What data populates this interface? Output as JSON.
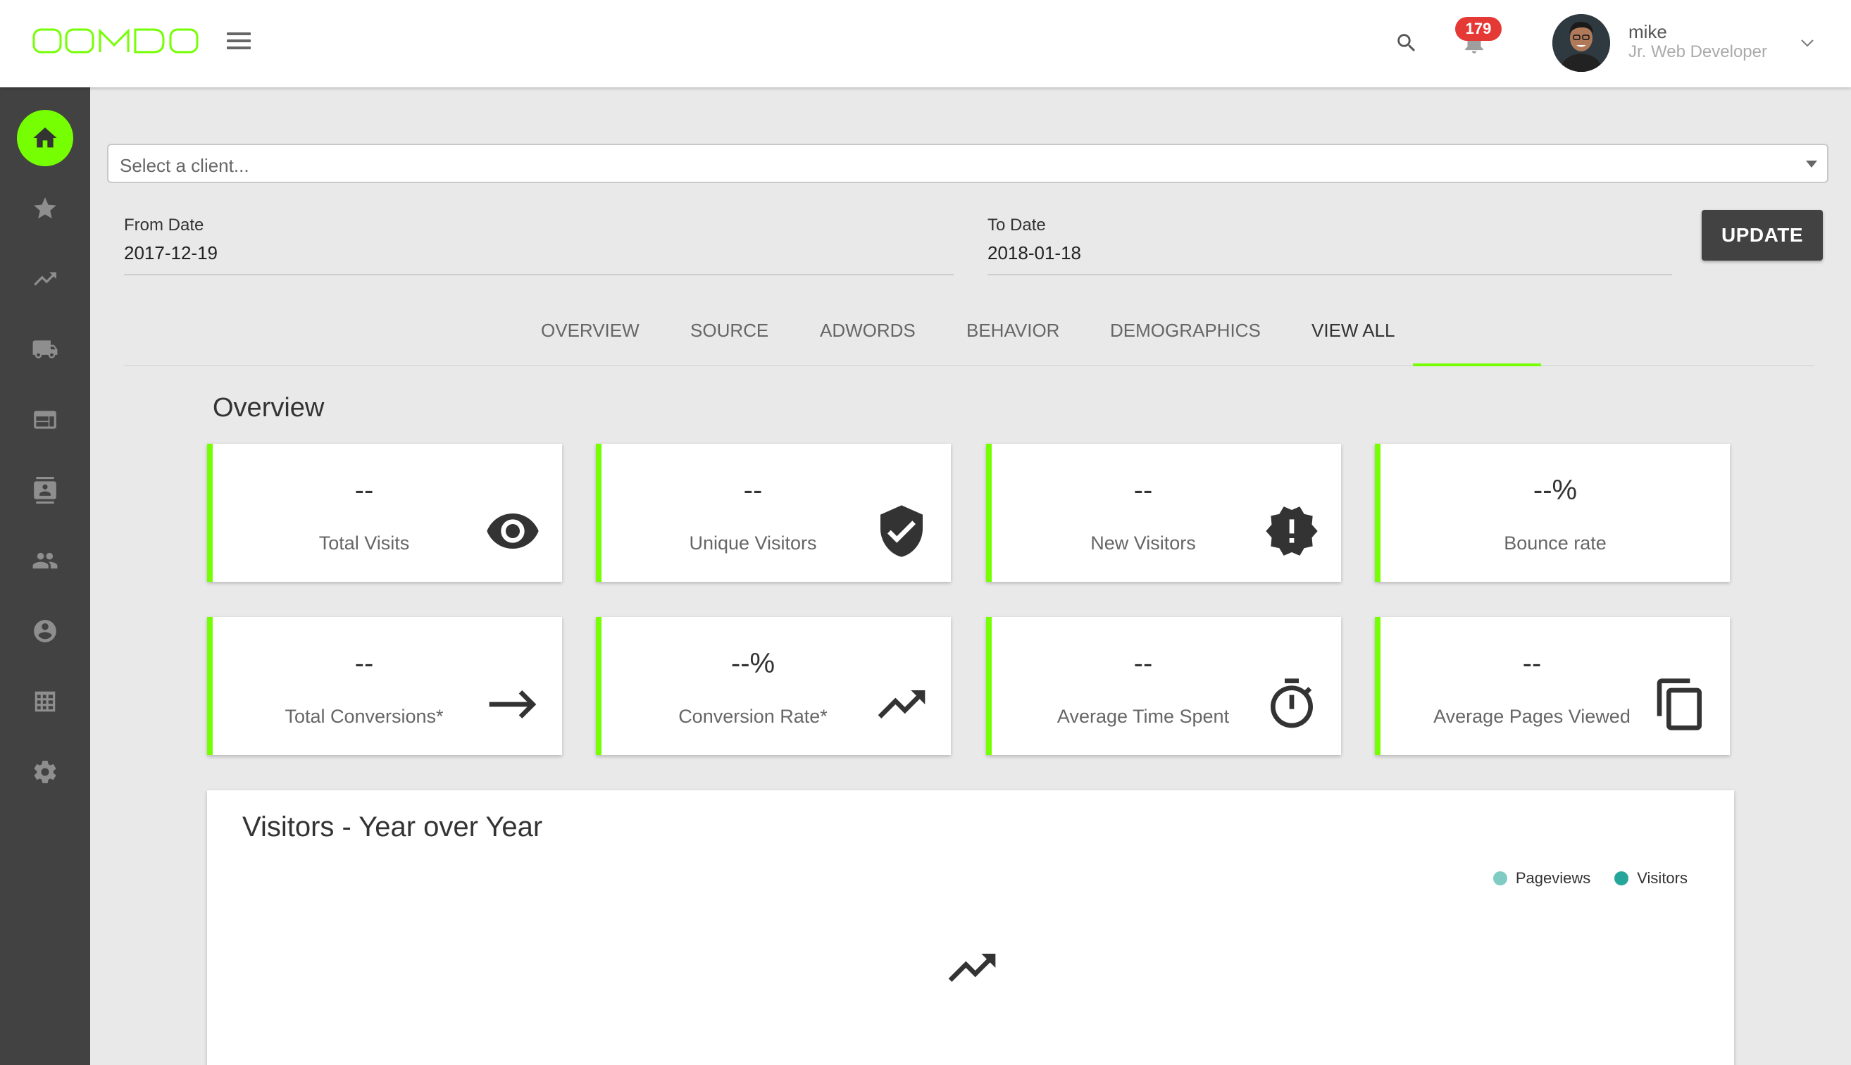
{
  "app": {
    "logo_text": "OOMDO",
    "brand_color": "#76ff03",
    "sidebar_color": "#424242"
  },
  "header": {
    "notifications_count": "179",
    "user": {
      "name": "mike",
      "role": "Jr. Web Developer"
    }
  },
  "sidebar": {
    "items": [
      {
        "icon": "home-icon",
        "active": true
      },
      {
        "icon": "star-icon"
      },
      {
        "icon": "trending-up-icon"
      },
      {
        "icon": "truck-icon"
      },
      {
        "icon": "web-icon"
      },
      {
        "icon": "contact-card-icon"
      },
      {
        "icon": "people-icon"
      },
      {
        "icon": "account-circle-icon"
      },
      {
        "icon": "table-grid-icon"
      },
      {
        "icon": "gear-icon"
      }
    ]
  },
  "filters": {
    "client_placeholder": "Select a client...",
    "from_label": "From Date",
    "from_value": "2017-12-19",
    "to_label": "To Date",
    "to_value": "2018-01-18",
    "update_label": "UPDATE"
  },
  "tabs": [
    {
      "label": "OVERVIEW"
    },
    {
      "label": "SOURCE"
    },
    {
      "label": "ADWORDS"
    },
    {
      "label": "BEHAVIOR"
    },
    {
      "label": "DEMOGRAPHICS"
    },
    {
      "label": "VIEW ALL",
      "active": true
    }
  ],
  "overview": {
    "title": "Overview",
    "cards": [
      {
        "value": "--",
        "label": "Total Visits",
        "icon": "eye-icon"
      },
      {
        "value": "--",
        "label": "Unique Visitors",
        "icon": "verified-shield-icon"
      },
      {
        "value": "--",
        "label": "New Visitors",
        "icon": "alert-badge-icon"
      },
      {
        "value": "--%",
        "label": "Bounce rate",
        "icon": ""
      },
      {
        "value": "--",
        "label": "Total Conversions*",
        "icon": "arrow-right-icon"
      },
      {
        "value": "--%",
        "label": "Conversion Rate*",
        "icon": "trending-up-icon"
      },
      {
        "value": "--",
        "label": "Average Time Spent",
        "icon": "timer-icon"
      },
      {
        "value": "--",
        "label": "Average Pages Viewed",
        "icon": "copy-pages-icon"
      }
    ]
  },
  "chart_panel": {
    "title": "Visitors - Year over Year",
    "legend": [
      {
        "label": "Pageviews",
        "color": "#80cbc4"
      },
      {
        "label": "Visitors",
        "color": "#26a69a"
      }
    ]
  }
}
